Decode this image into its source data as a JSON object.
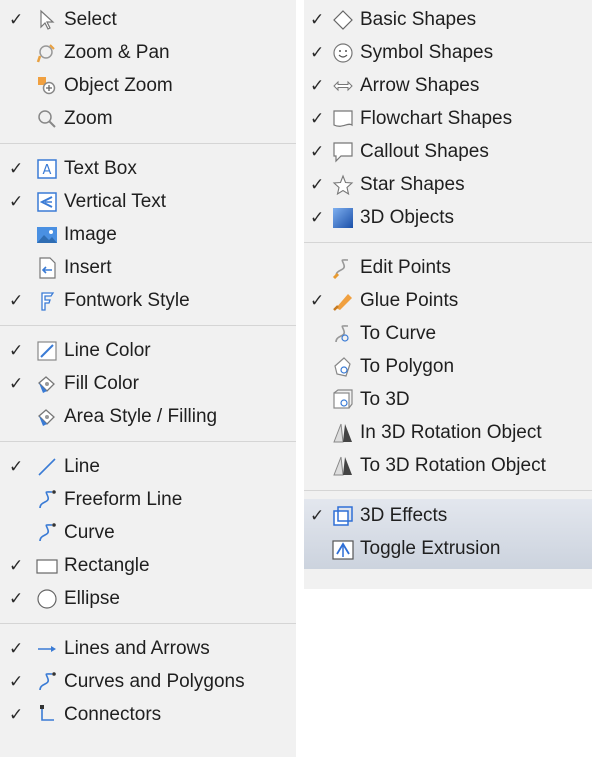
{
  "left_menu": {
    "groups": [
      {
        "items": [
          {
            "label": "Select",
            "checked": true,
            "icon": "arrow-pointer-icon"
          },
          {
            "label": "Zoom & Pan",
            "checked": false,
            "icon": "zoom-pan-icon"
          },
          {
            "label": "Object Zoom",
            "checked": false,
            "icon": "object-zoom-icon"
          },
          {
            "label": "Zoom",
            "checked": false,
            "icon": "magnifier-icon"
          }
        ]
      },
      {
        "items": [
          {
            "label": "Text Box",
            "checked": true,
            "icon": "text-box-icon"
          },
          {
            "label": "Vertical Text",
            "checked": true,
            "icon": "vertical-text-icon"
          },
          {
            "label": "Image",
            "checked": false,
            "icon": "image-icon"
          },
          {
            "label": "Insert",
            "checked": false,
            "icon": "insert-icon"
          },
          {
            "label": "Fontwork Style",
            "checked": true,
            "icon": "fontwork-icon"
          }
        ]
      },
      {
        "items": [
          {
            "label": "Line Color",
            "checked": true,
            "icon": "line-color-icon"
          },
          {
            "label": "Fill Color",
            "checked": true,
            "icon": "fill-color-icon"
          },
          {
            "label": "Area Style / Filling",
            "checked": false,
            "icon": "area-style-icon"
          }
        ]
      },
      {
        "items": [
          {
            "label": "Line",
            "checked": true,
            "icon": "line-icon"
          },
          {
            "label": "Freeform Line",
            "checked": false,
            "icon": "freeform-line-icon"
          },
          {
            "label": "Curve",
            "checked": false,
            "icon": "curve-icon"
          },
          {
            "label": "Rectangle",
            "checked": true,
            "icon": "rectangle-icon"
          },
          {
            "label": "Ellipse",
            "checked": true,
            "icon": "ellipse-icon"
          }
        ]
      },
      {
        "items": [
          {
            "label": "Lines and Arrows",
            "checked": true,
            "icon": "lines-arrows-icon"
          },
          {
            "label": "Curves and Polygons",
            "checked": true,
            "icon": "curves-polygons-icon"
          },
          {
            "label": "Connectors",
            "checked": true,
            "icon": "connectors-icon"
          }
        ]
      }
    ]
  },
  "right_menu": {
    "groups": [
      {
        "items": [
          {
            "label": "Basic Shapes",
            "checked": true,
            "icon": "diamond-icon"
          },
          {
            "label": "Symbol Shapes",
            "checked": true,
            "icon": "smiley-icon"
          },
          {
            "label": "Arrow Shapes",
            "checked": true,
            "icon": "double-arrow-icon"
          },
          {
            "label": "Flowchart Shapes",
            "checked": true,
            "icon": "flowchart-icon"
          },
          {
            "label": "Callout Shapes",
            "checked": true,
            "icon": "callout-icon"
          },
          {
            "label": "Star Shapes",
            "checked": true,
            "icon": "star-icon"
          },
          {
            "label": "3D Objects",
            "checked": true,
            "icon": "cube-icon"
          }
        ]
      },
      {
        "items": [
          {
            "label": "Edit Points",
            "checked": false,
            "icon": "edit-points-icon"
          },
          {
            "label": "Glue Points",
            "checked": true,
            "icon": "glue-points-icon"
          },
          {
            "label": "To Curve",
            "checked": false,
            "icon": "to-curve-icon"
          },
          {
            "label": "To Polygon",
            "checked": false,
            "icon": "to-polygon-icon"
          },
          {
            "label": "To 3D",
            "checked": false,
            "icon": "to-3d-icon"
          },
          {
            "label": "In 3D Rotation Object",
            "checked": false,
            "icon": "in-3d-rotation-icon"
          },
          {
            "label": "To 3D Rotation Object",
            "checked": false,
            "icon": "to-3d-rotation-icon"
          }
        ]
      },
      {
        "items": [
          {
            "label": "3D Effects",
            "checked": true,
            "icon": "3d-effects-icon"
          },
          {
            "label": "Toggle Extrusion",
            "checked": false,
            "icon": "toggle-extrusion-icon"
          }
        ]
      }
    ]
  },
  "check_glyph": "✓",
  "colors": {
    "menu_bg": "#f1f1f1",
    "separator": "#d5d5d5",
    "accent_blue": "#2f6fd6"
  }
}
